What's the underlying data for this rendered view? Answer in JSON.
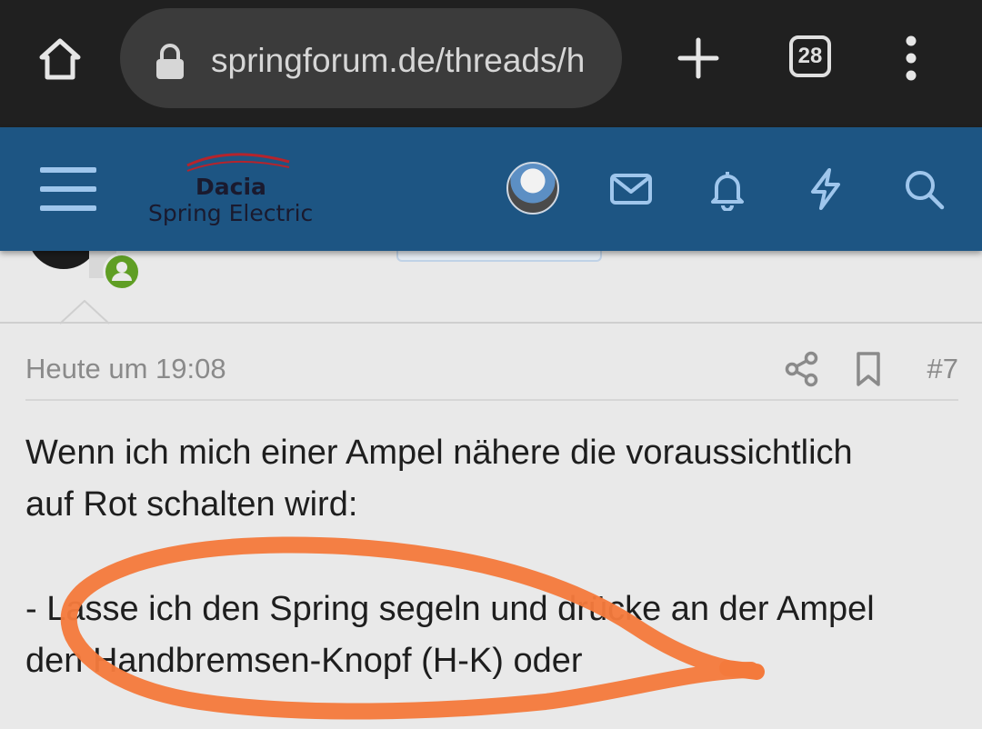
{
  "browser": {
    "url": "springforum.de/threads/h",
    "tab_count": "28",
    "icons": [
      "home-icon",
      "lock-icon",
      "plus-icon",
      "tab-switcher-icon",
      "more-vertical-icon"
    ]
  },
  "forum": {
    "logo_brand": "Dacia",
    "logo_sub": "Spring Electric",
    "header_color": "#1d5583",
    "icons": [
      "hamburger-menu-icon",
      "avatar",
      "mail-icon",
      "bell-icon",
      "lightning-icon",
      "search-icon"
    ]
  },
  "post": {
    "time": "Heute um 19:08",
    "number": "#7",
    "paragraph1_line1": "Wenn ich mich einer Ampel nähere die voraussichtlich",
    "paragraph1_line2": "auf Rot schalten wird:",
    "paragraph2_line1": "- Lasse ich den Spring segeln und drücke an der Ampel",
    "paragraph2_line2": "den Handbremsen-Knopf (H-K) oder"
  },
  "annotation": {
    "scribble_color": "#f47a3c"
  }
}
